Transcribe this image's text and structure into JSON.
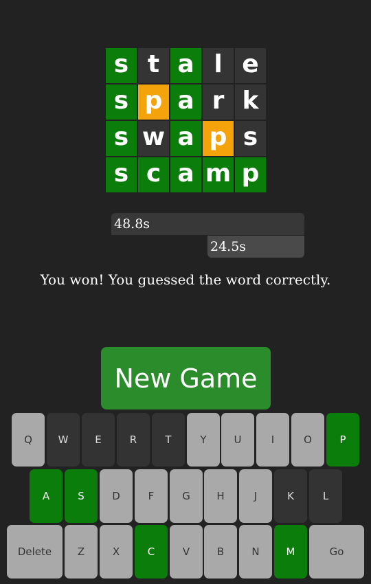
{
  "board": {
    "rows": [
      [
        {
          "letter": "s",
          "state": "correct"
        },
        {
          "letter": "t",
          "state": "absent"
        },
        {
          "letter": "a",
          "state": "correct"
        },
        {
          "letter": "l",
          "state": "absent"
        },
        {
          "letter": "e",
          "state": "absent"
        }
      ],
      [
        {
          "letter": "s",
          "state": "correct"
        },
        {
          "letter": "p",
          "state": "present"
        },
        {
          "letter": "a",
          "state": "correct"
        },
        {
          "letter": "r",
          "state": "absent"
        },
        {
          "letter": "k",
          "state": "absent"
        }
      ],
      [
        {
          "letter": "s",
          "state": "correct"
        },
        {
          "letter": "w",
          "state": "absent"
        },
        {
          "letter": "a",
          "state": "correct"
        },
        {
          "letter": "p",
          "state": "present"
        },
        {
          "letter": "s",
          "state": "absent"
        }
      ],
      [
        {
          "letter": "s",
          "state": "correct"
        },
        {
          "letter": "c",
          "state": "correct"
        },
        {
          "letter": "a",
          "state": "correct"
        },
        {
          "letter": "m",
          "state": "correct"
        },
        {
          "letter": "p",
          "state": "correct"
        }
      ]
    ]
  },
  "timers": {
    "total": "48.8s",
    "current": "24.5s"
  },
  "message": "You won! You guessed the word correctly.",
  "new_game_label": "New Game",
  "keyboard": {
    "rows": [
      [
        {
          "label": "Q",
          "state": "unused"
        },
        {
          "label": "W",
          "state": "absent"
        },
        {
          "label": "E",
          "state": "absent"
        },
        {
          "label": "R",
          "state": "absent"
        },
        {
          "label": "T",
          "state": "absent"
        },
        {
          "label": "Y",
          "state": "unused"
        },
        {
          "label": "U",
          "state": "unused"
        },
        {
          "label": "I",
          "state": "unused"
        },
        {
          "label": "O",
          "state": "unused"
        },
        {
          "label": "P",
          "state": "correct"
        }
      ],
      [
        {
          "label": "A",
          "state": "correct"
        },
        {
          "label": "S",
          "state": "correct"
        },
        {
          "label": "D",
          "state": "unused"
        },
        {
          "label": "F",
          "state": "unused"
        },
        {
          "label": "G",
          "state": "unused"
        },
        {
          "label": "H",
          "state": "unused"
        },
        {
          "label": "J",
          "state": "unused"
        },
        {
          "label": "K",
          "state": "absent"
        },
        {
          "label": "L",
          "state": "absent"
        }
      ],
      [
        {
          "label": "Delete",
          "state": "unused"
        },
        {
          "label": "Z",
          "state": "unused"
        },
        {
          "label": "X",
          "state": "unused"
        },
        {
          "label": "C",
          "state": "correct"
        },
        {
          "label": "V",
          "state": "unused"
        },
        {
          "label": "B",
          "state": "unused"
        },
        {
          "label": "N",
          "state": "unused"
        },
        {
          "label": "M",
          "state": "correct"
        },
        {
          "label": "Go",
          "state": "unused"
        }
      ]
    ]
  },
  "colors": {
    "correct": "#0a7d0a",
    "present": "#f5a30b",
    "absent": "#343434",
    "unused": "#a9a9a9",
    "background": "#222222"
  }
}
